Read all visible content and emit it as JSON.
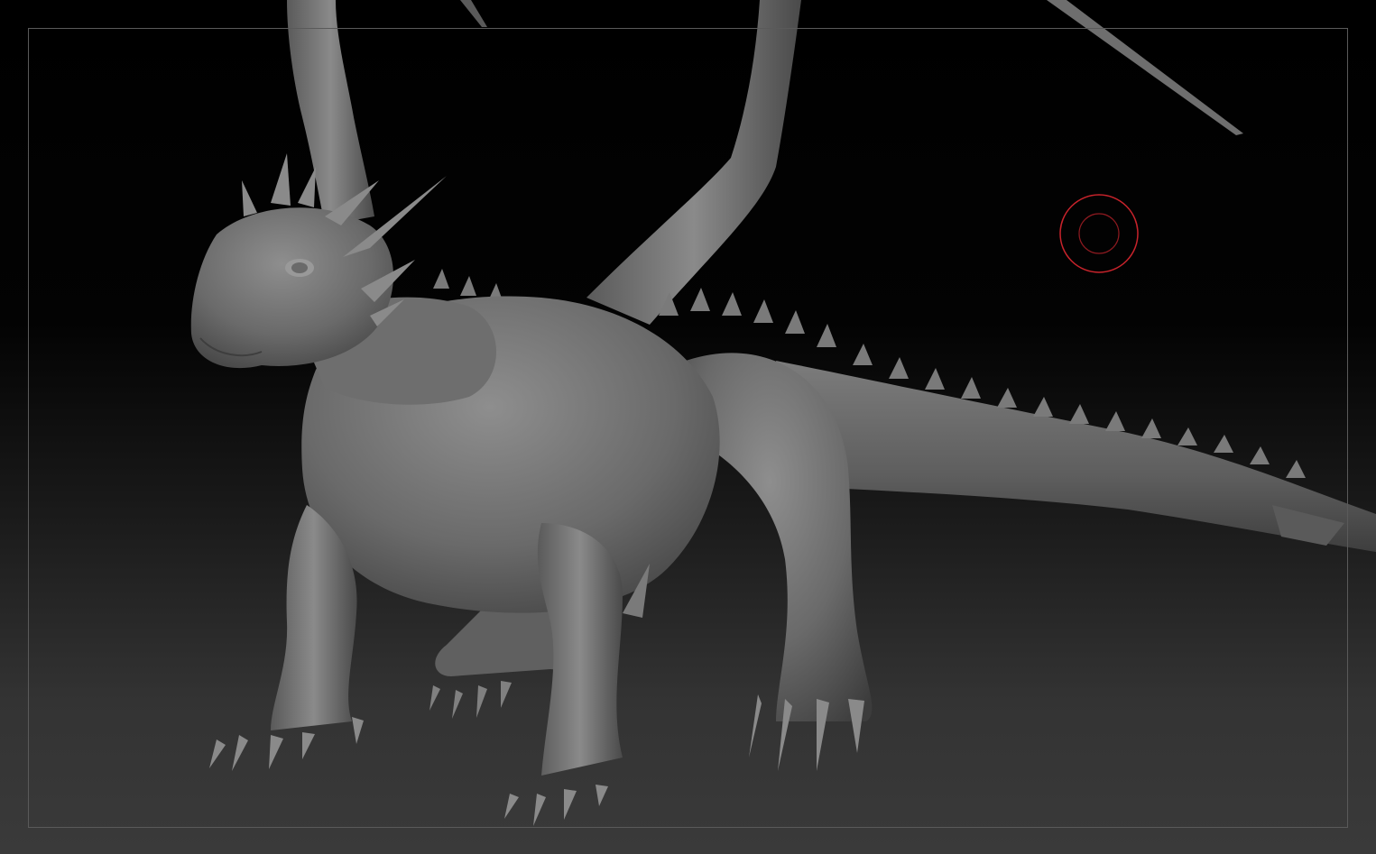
{
  "app": {
    "view": "zbrush-document-canvas",
    "model": "dragon-sculpt"
  },
  "colors": {
    "background_top": "#000000",
    "background_bottom": "#3a3a3a",
    "frame_border": "#5a5a5a",
    "clay_light": "#8e8e8e",
    "clay_mid": "#6a6a6a",
    "clay_dark": "#3c3c3c",
    "brush_cursor": "#c8232b"
  },
  "icons": {
    "brush_cursor": "brush-cursor-icon"
  }
}
